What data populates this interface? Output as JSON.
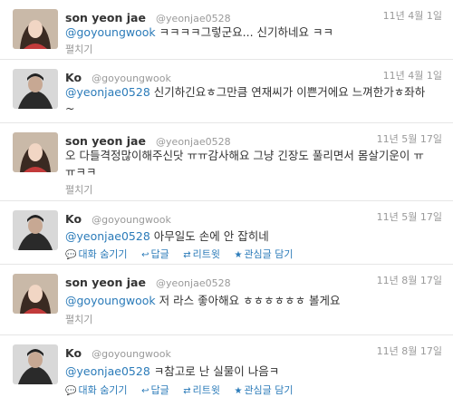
{
  "tweets": [
    {
      "name": "son yeon jae",
      "handle": "@yeonjae0528",
      "date": "11년 4월 1일",
      "mention": "@goyoungwook",
      "text": " ㅋㅋㅋㅋ그렇군요... 신기하네요 ㅋㅋ",
      "action": "펼치기"
    },
    {
      "name": "Ko",
      "handle": "@goyoungwook",
      "date": "11년 4월 1일",
      "mention": "@yeonjae0528",
      "text": " 신기하긴요ㅎ그만큼 연재씨가 이쁜거에요 느껴한가ㅎ좌하~"
    },
    {
      "name": "son yeon jae",
      "handle": "@yeonjae0528",
      "date": "11년 5월 17일",
      "mention": "",
      "text": "오 다들격정많이해주신닷 ㅠㅠ감사해요 그냥 긴장도 풀리면서 몸살기운이 ㅠㅠㅋㅋ",
      "action": "펼치기"
    },
    {
      "name": "Ko",
      "handle": "@goyoungwook",
      "date": "11년 5월 17일",
      "mention": "@yeonjae0528",
      "text": " 아무일도 손에 안 잡히네",
      "actions": [
        "대화 숨기기",
        "답글",
        "리트윗",
        "관심글 담기"
      ]
    },
    {
      "name": "son yeon jae",
      "handle": "@yeonjae0528",
      "date": "11년 8월 17일",
      "mention": "@goyoungwook",
      "text": " 저 라스 좋아해요 ㅎㅎㅎㅎㅎㅎ 볼게요",
      "action": "펼치기"
    },
    {
      "name": "Ko",
      "handle": "@goyoungwook",
      "date": "11년 8월 17일",
      "mention": "@yeonjae0528",
      "text": " ㅋ참고로 난 실물이 나음ㅋ",
      "actions": [
        "대화 숨기기",
        "답글",
        "리트윗",
        "관심글 담기"
      ]
    }
  ],
  "colors": {
    "link": "#2b7bb9",
    "meta": "#999999",
    "text": "#333333"
  }
}
